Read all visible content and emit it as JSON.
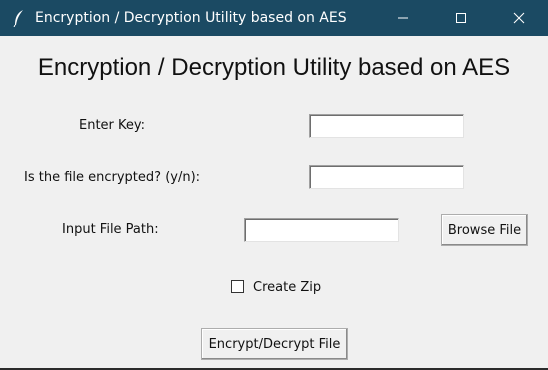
{
  "window": {
    "title": "Encryption / Decryption Utility based on AES",
    "titlebar_color": "#1b4a63",
    "icons": [
      "feather-icon",
      "minimize-icon",
      "maximize-icon",
      "close-icon"
    ]
  },
  "main": {
    "heading": "Encryption / Decryption Utility based on AES",
    "key_label": "Enter Key:",
    "key_value": "",
    "encrypted_label": "Is the file encrypted? (y/n):",
    "encrypted_value": "",
    "path_label": "Input File Path:",
    "path_value": "",
    "browse_label": "Browse File",
    "zip_label": "Create Zip",
    "zip_checked": false,
    "action_label": "Encrypt/Decrypt File"
  }
}
